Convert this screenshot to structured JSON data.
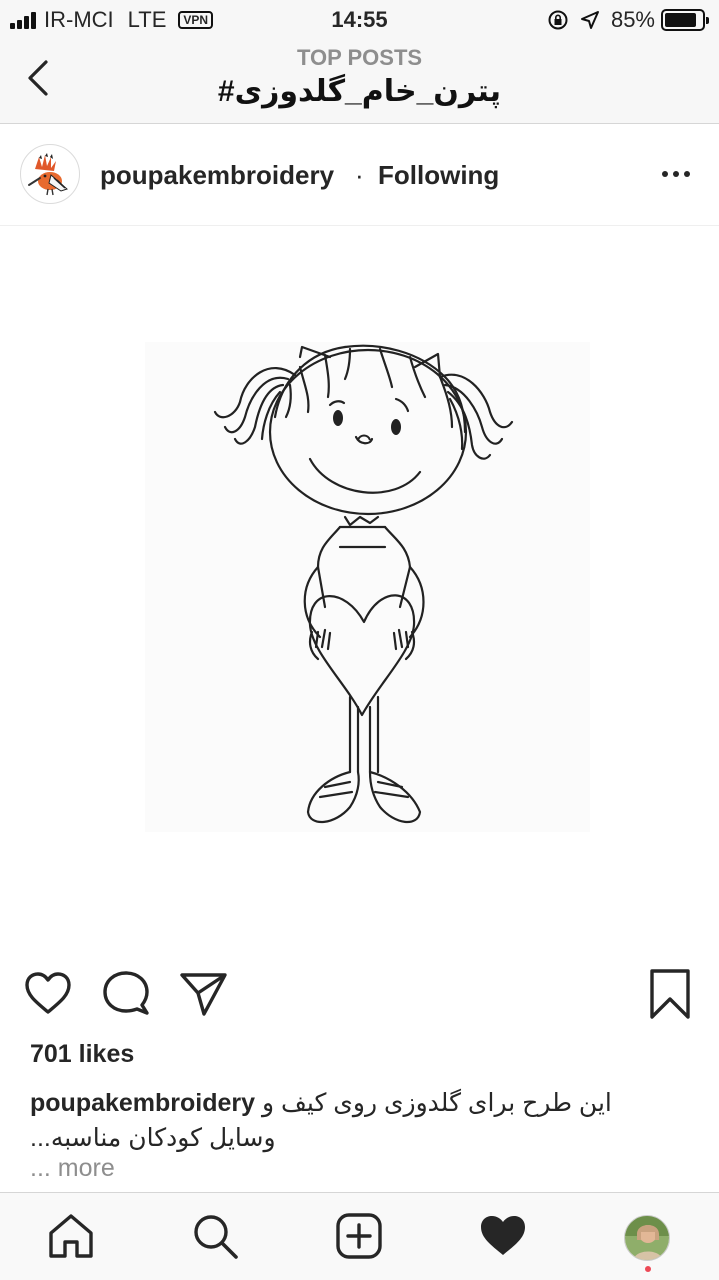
{
  "status_bar": {
    "carrier": "IR-MCI",
    "network": "LTE",
    "vpn": "VPN",
    "time": "14:55",
    "battery_percent": "85%",
    "battery_level": 0.85
  },
  "header": {
    "subtitle": "TOP POSTS",
    "title": "#پترن_خام_گلدوزی"
  },
  "post": {
    "username": "poupakembroidery",
    "separator": "·",
    "follow_status": "Following",
    "likes": "701 likes",
    "caption_user": "poupakembroidery",
    "caption_line1": "این طرح برای گلدوزی روی کیف و",
    "caption_line2": "...وسایل کودکان مناسبه",
    "more": "... more"
  },
  "icons": {
    "back": "chevron-left-icon",
    "more": "ellipsis-icon",
    "like": "heart-outline-icon",
    "comment": "comment-icon",
    "share": "paper-plane-icon",
    "save": "bookmark-icon",
    "home": "home-icon",
    "search": "search-icon",
    "add": "plus-square-icon",
    "activity": "heart-filled-icon"
  },
  "colors": {
    "secondary_text": "#8e8e8e",
    "notification_dot": "#ed4956"
  }
}
